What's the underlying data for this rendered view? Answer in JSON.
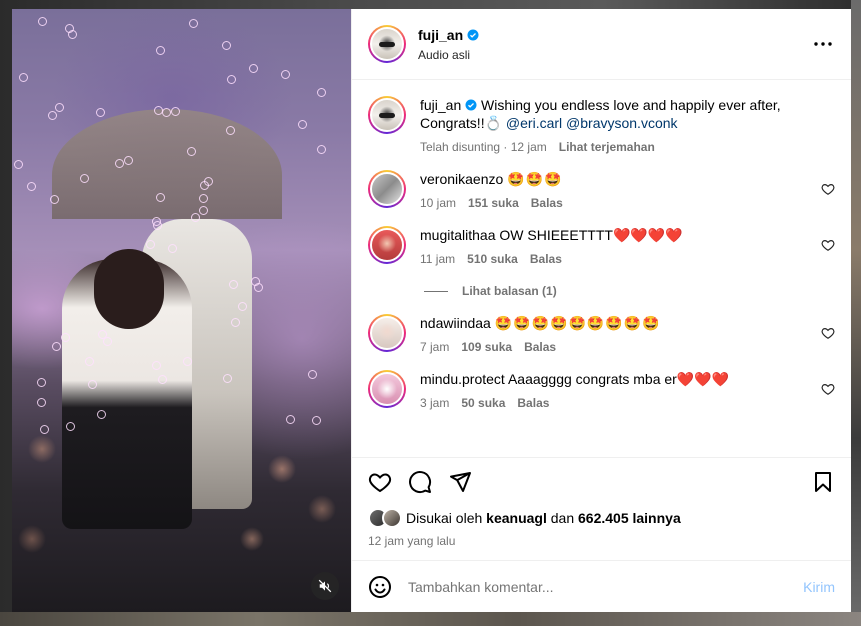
{
  "post": {
    "author": "fuji_an",
    "subtitle": "Audio asli",
    "verified": true,
    "caption": {
      "username": "fuji_an",
      "text": "Wishing you endless love and happily ever after, Congrats!!💍",
      "mention1": "@eri.carl",
      "mention2": "@bravyson.vconk",
      "edited": "Telah disunting",
      "time": "12 jam",
      "translate": "Lihat terjemahan"
    }
  },
  "comments": [
    {
      "username": "veronikaenzo",
      "text": "🤩🤩🤩",
      "time": "10 jam",
      "likes": "151 suka",
      "reply": "Balas"
    },
    {
      "username": "mugitalithaa",
      "text": "OW SHIEEETTTT❤️❤️❤️❤️",
      "time": "11 jam",
      "likes": "510 suka",
      "reply": "Balas"
    },
    {
      "username": "ndawiindaa",
      "text": "🤩🤩🤩🤩🤩🤩🤩🤩🤩",
      "time": "7 jam",
      "likes": "109 suka",
      "reply": "Balas"
    },
    {
      "username": "mindu.protect",
      "text": "Aaaagggg congrats mba er❤️❤️❤️",
      "time": "3 jam",
      "likes": "50 suka",
      "reply": "Balas"
    }
  ],
  "view_replies": "Lihat balasan (1)",
  "likes": {
    "prefix": "Disukai oleh",
    "user": "keanuagl",
    "middle": "dan",
    "count": "662.405 lainnya"
  },
  "timeago": "12 jam yang lalu",
  "comment_box": {
    "placeholder": "Tambahkan komentar...",
    "post": "Kirim"
  },
  "icons": {
    "like": "heart-icon",
    "comment": "comment-icon",
    "share": "send-icon",
    "save": "bookmark-icon",
    "more": "more-horizontal-icon",
    "mute": "speaker-muted-icon",
    "emoji": "emoji-icon"
  },
  "colors": {
    "mention": "#00376b",
    "secondary_text": "#737373",
    "post_button": "#93c5fd",
    "verified": "#0095f6"
  }
}
